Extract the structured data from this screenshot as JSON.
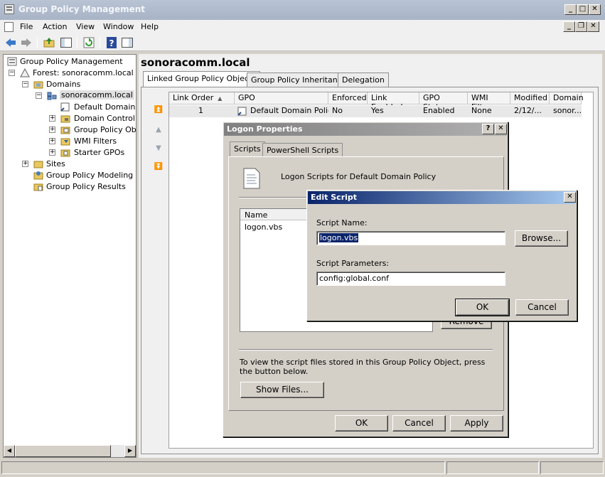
{
  "window": {
    "title": "Group Policy Management"
  },
  "menu": [
    "File",
    "Action",
    "View",
    "Window",
    "Help"
  ],
  "tree": {
    "root": "Group Policy Management",
    "forest": "Forest: sonoracomm.local",
    "domains": "Domains",
    "domain": "sonoracomm.local",
    "children": [
      "Default Domain Po",
      "Domain Controller",
      "Group Policy Obje",
      "WMI Filters",
      "Starter GPOs"
    ],
    "sites": "Sites",
    "modeling": "Group Policy Modeling",
    "results": "Group Policy Results"
  },
  "main": {
    "title": "sonoracomm.local",
    "tabs": [
      "Linked Group Policy Objects",
      "Group Policy Inheritance",
      "Delegation"
    ],
    "columns": [
      "Link Order",
      "GPO",
      "Enforced",
      "Link Enabled",
      "GPO Status",
      "WMI Filter",
      "Modified",
      "Domain"
    ],
    "row": [
      "1",
      "Default Domain Policy",
      "No",
      "Yes",
      "Enabled",
      "None",
      "2/12/...",
      "sonor..."
    ]
  },
  "logon_dialog": {
    "title": "Logon Properties",
    "help": "?",
    "tabs": [
      "Scripts",
      "PowerShell Scripts"
    ],
    "heading": "Logon Scripts for Default Domain Policy",
    "list_header": "Name",
    "list_item": "logon.vbs",
    "remove": "Remove",
    "info_line1": "To view the script files stored in this Group Policy Object, press",
    "info_line2": "the button below.",
    "show_files": "Show Files...",
    "ok": "OK",
    "cancel": "Cancel",
    "apply": "Apply"
  },
  "edit_dialog": {
    "title": "Edit Script",
    "name_label": "Script Name:",
    "name_value": "logon.vbs",
    "browse": "Browse...",
    "params_label": "Script Parameters:",
    "params_value": "config:global.conf",
    "ok": "OK",
    "cancel": "Cancel"
  },
  "colors": {
    "titlebar_inactive": "#a8b4c6",
    "titlebar_active": "#0a246a",
    "selection": "#0a246a"
  }
}
